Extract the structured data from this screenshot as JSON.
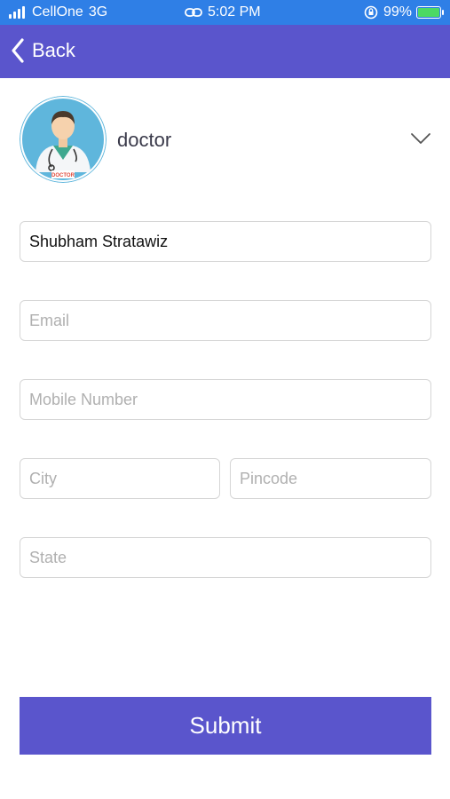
{
  "status_bar": {
    "carrier": "CellOne",
    "network": "3G",
    "time": "5:02 PM",
    "battery": "99%",
    "battery_level": 0.99,
    "icons": [
      "signal-icon",
      "link-icon",
      "orientation-lock-icon",
      "battery-charging-icon"
    ]
  },
  "nav": {
    "back_label": "Back",
    "back_icon": "chevron-left-icon"
  },
  "role": {
    "selected": "doctor",
    "avatar_badge": "DOCTOR",
    "dropdown_icon": "chevron-down-icon"
  },
  "form": {
    "name": {
      "value": "Shubham Stratawiz",
      "placeholder": ""
    },
    "email": {
      "value": "",
      "placeholder": "Email"
    },
    "mobile": {
      "value": "",
      "placeholder": "Mobile Number"
    },
    "city": {
      "value": "",
      "placeholder": "City"
    },
    "pincode": {
      "value": "",
      "placeholder": "Pincode"
    },
    "state": {
      "value": "",
      "placeholder": "State"
    }
  },
  "submit_label": "Submit",
  "colors": {
    "status_bar": "#2f7fe6",
    "accent": "#5a55cc",
    "field_border": "#d6d6d6",
    "placeholder": "#b0b0b0"
  }
}
